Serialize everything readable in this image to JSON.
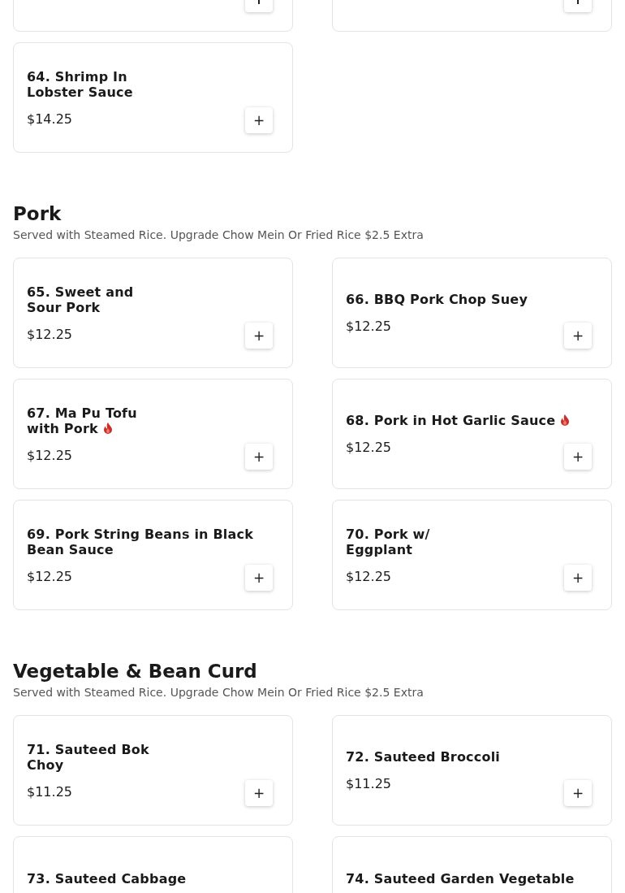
{
  "sections": [
    {
      "items": [
        {
          "kind": "cut_top"
        },
        {
          "kind": "cut_top"
        },
        {
          "kind": "full",
          "title": "64. Shrimp In\nLobster Sauce",
          "spicy": false,
          "price": "$14.25",
          "add_button": "+"
        }
      ]
    },
    {
      "heading": "Pork",
      "description": "Served with Steamed Rice. Upgrade Chow Mein Or Fried Rice $2.5 Extra",
      "items": [
        {
          "kind": "full",
          "title": "65. Sweet and\nSour Pork",
          "spicy": false,
          "price": "$12.25",
          "add_button": "+"
        },
        {
          "kind": "full",
          "title": "66. BBQ Pork Chop Suey",
          "spicy": false,
          "price": "$12.25",
          "add_button": "+"
        },
        {
          "kind": "full",
          "title": "67. Ma Pu Tofu\nwith Pork",
          "spicy": true,
          "price": "$12.25",
          "add_button": "+"
        },
        {
          "kind": "full",
          "title": "68. Pork in Hot Garlic Sauce",
          "spicy": true,
          "price": "$12.25",
          "add_button": "+"
        },
        {
          "kind": "full",
          "title": "69. Pork String Beans in Black\nBean Sauce",
          "spicy": false,
          "price": "$12.25",
          "add_button": "+"
        },
        {
          "kind": "full",
          "title": "70. Pork w/\nEggplant",
          "spicy": false,
          "price": "$12.25",
          "add_button": "+"
        }
      ]
    },
    {
      "heading": "Vegetable & Bean Curd",
      "description": "Served with Steamed Rice. Upgrade Chow Mein Or Fried Rice $2.5 Extra",
      "items": [
        {
          "kind": "full",
          "title": "71. Sauteed Bok\nChoy",
          "spicy": false,
          "price": "$11.25",
          "add_button": "+"
        },
        {
          "kind": "full",
          "title": "72. Sauteed Broccoli",
          "spicy": false,
          "price": "$11.25",
          "add_button": "+"
        },
        {
          "kind": "cut_bottom",
          "title": "73. Sauteed Cabbage",
          "spicy": false
        },
        {
          "kind": "cut_bottom",
          "title": "74. Sauteed Garden Vegetable",
          "spicy": false
        }
      ]
    }
  ]
}
